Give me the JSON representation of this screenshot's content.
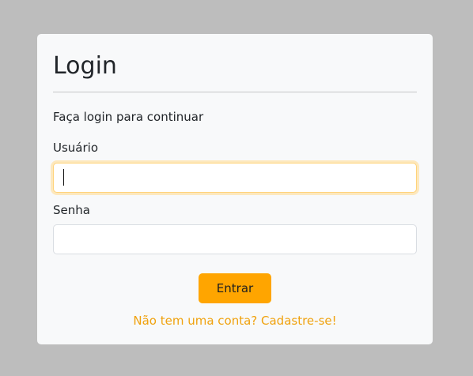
{
  "login": {
    "title": "Login",
    "subtitle": "Faça login para continuar",
    "username_label": "Usuário",
    "username_value": "",
    "password_label": "Senha",
    "password_value": "",
    "submit_label": "Entrar",
    "register_link": "Não tem uma conta? Cadastre-se!"
  },
  "colors": {
    "background": "#bdbdbd",
    "card": "#f8f9fa",
    "accent": "#ffa500",
    "link": "#f0a20e",
    "focus_ring": "#fde8bd"
  }
}
